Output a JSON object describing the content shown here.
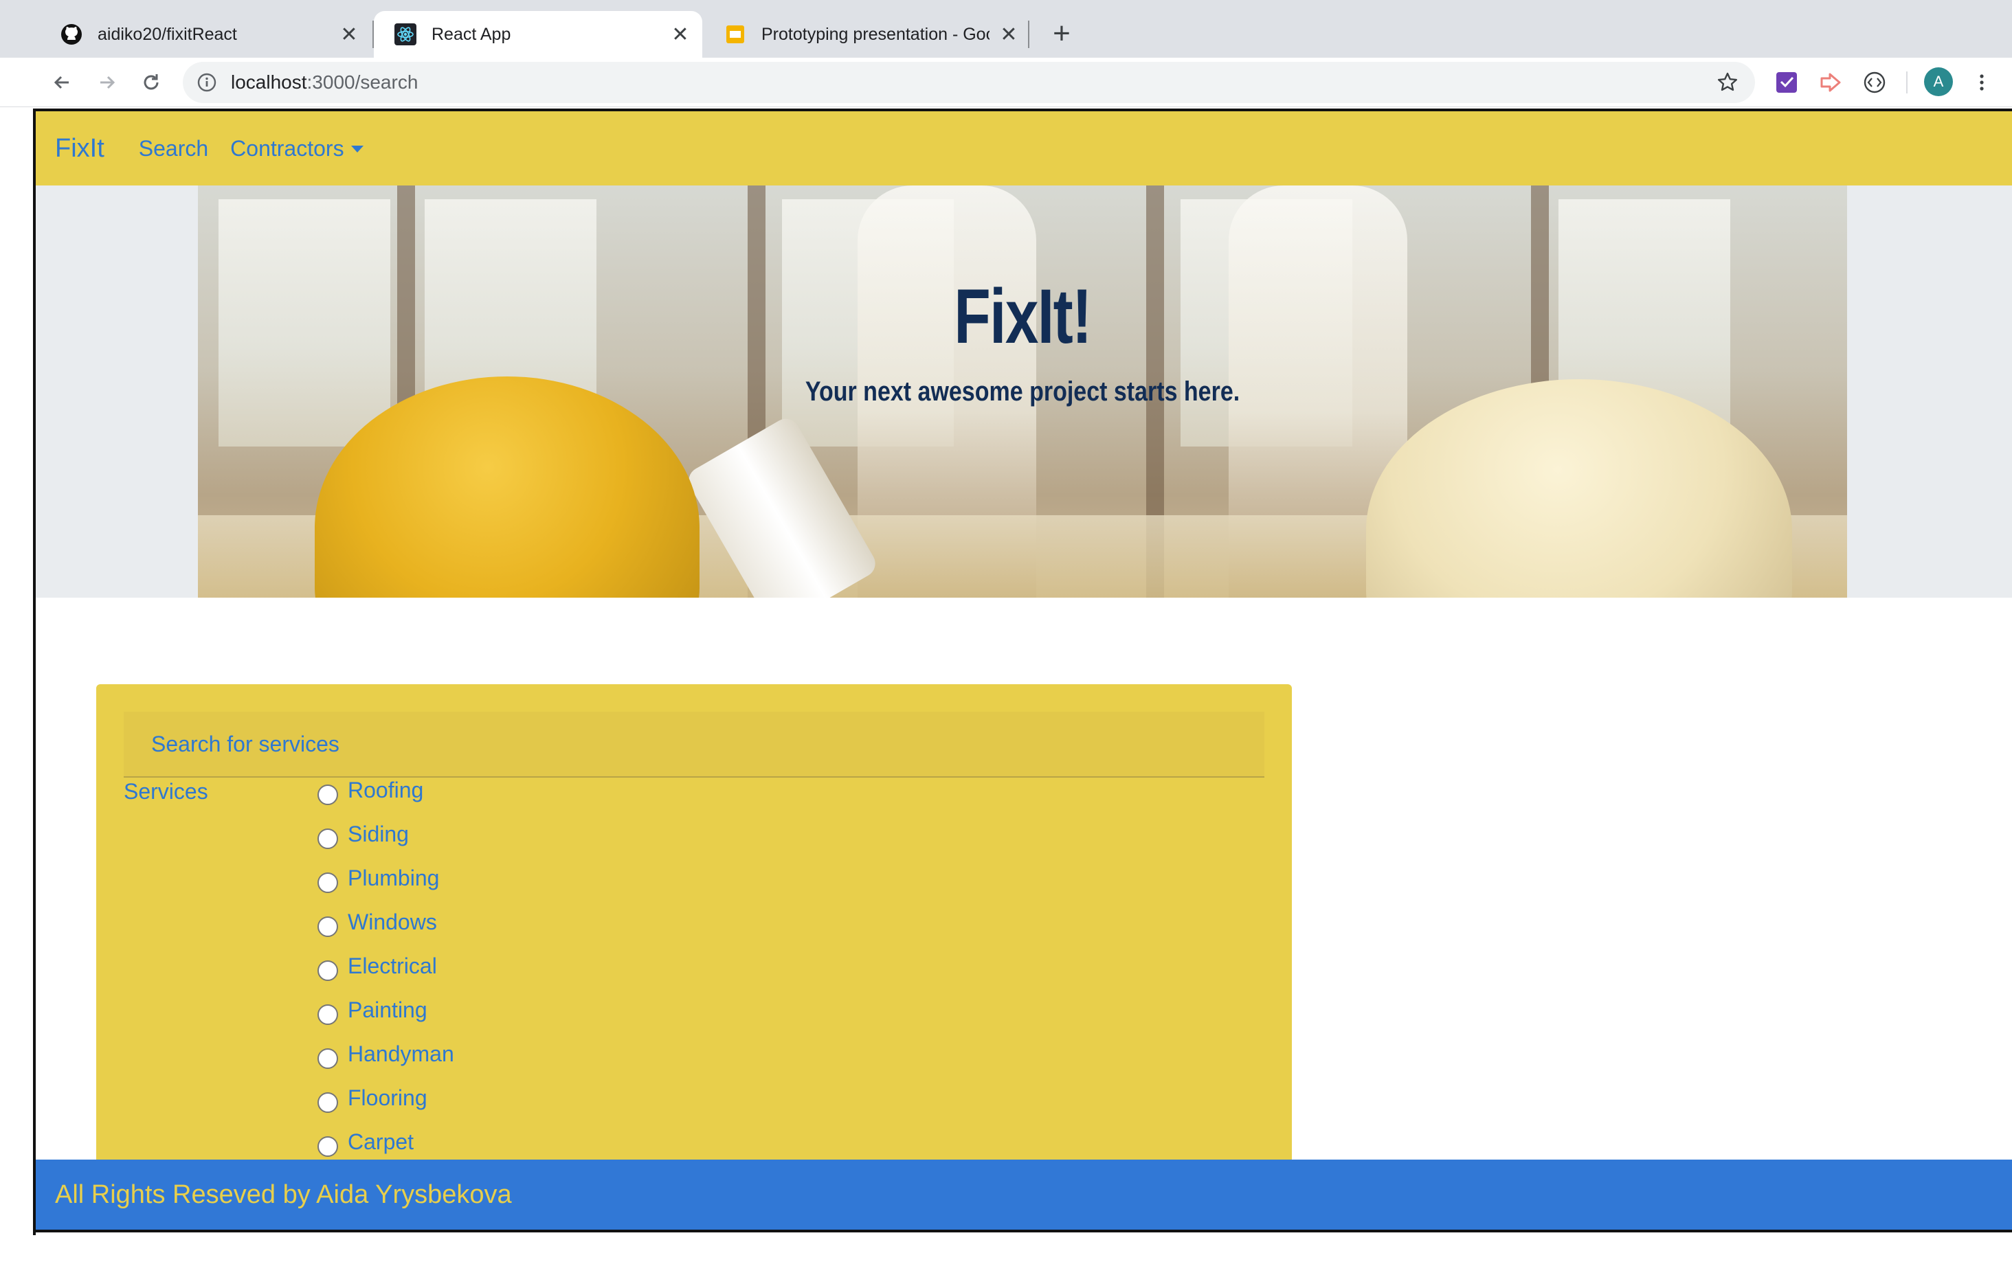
{
  "browser": {
    "tabs": [
      {
        "title": "aidiko20/fixitReact",
        "icon": "github-icon"
      },
      {
        "title": "React App",
        "icon": "react-icon",
        "active": true
      },
      {
        "title": "Prototyping presentation - Goo",
        "icon": "slides-icon"
      }
    ],
    "url": {
      "host": "localhost",
      "path": ":3000/search"
    },
    "profile_initial": "A"
  },
  "navbar": {
    "brand": "FixIt",
    "links": [
      "Search",
      "Contractors"
    ]
  },
  "hero": {
    "title": "FixIt!",
    "subtitle": "Your next awesome project starts here."
  },
  "search": {
    "header": "Search for services",
    "services_label": "Services",
    "options": [
      "Roofing",
      "Siding",
      "Plumbing",
      "Windows",
      "Electrical",
      "Painting",
      "Handyman",
      "Flooring",
      "Carpet"
    ]
  },
  "footer": {
    "text": "All Rights Reseved by Aida Yrysbekova"
  },
  "colors": {
    "brand_yellow": "#e8cf4b",
    "link_blue": "#2e78d1",
    "footer_blue": "#3178d6",
    "hero_text": "#122d55"
  }
}
